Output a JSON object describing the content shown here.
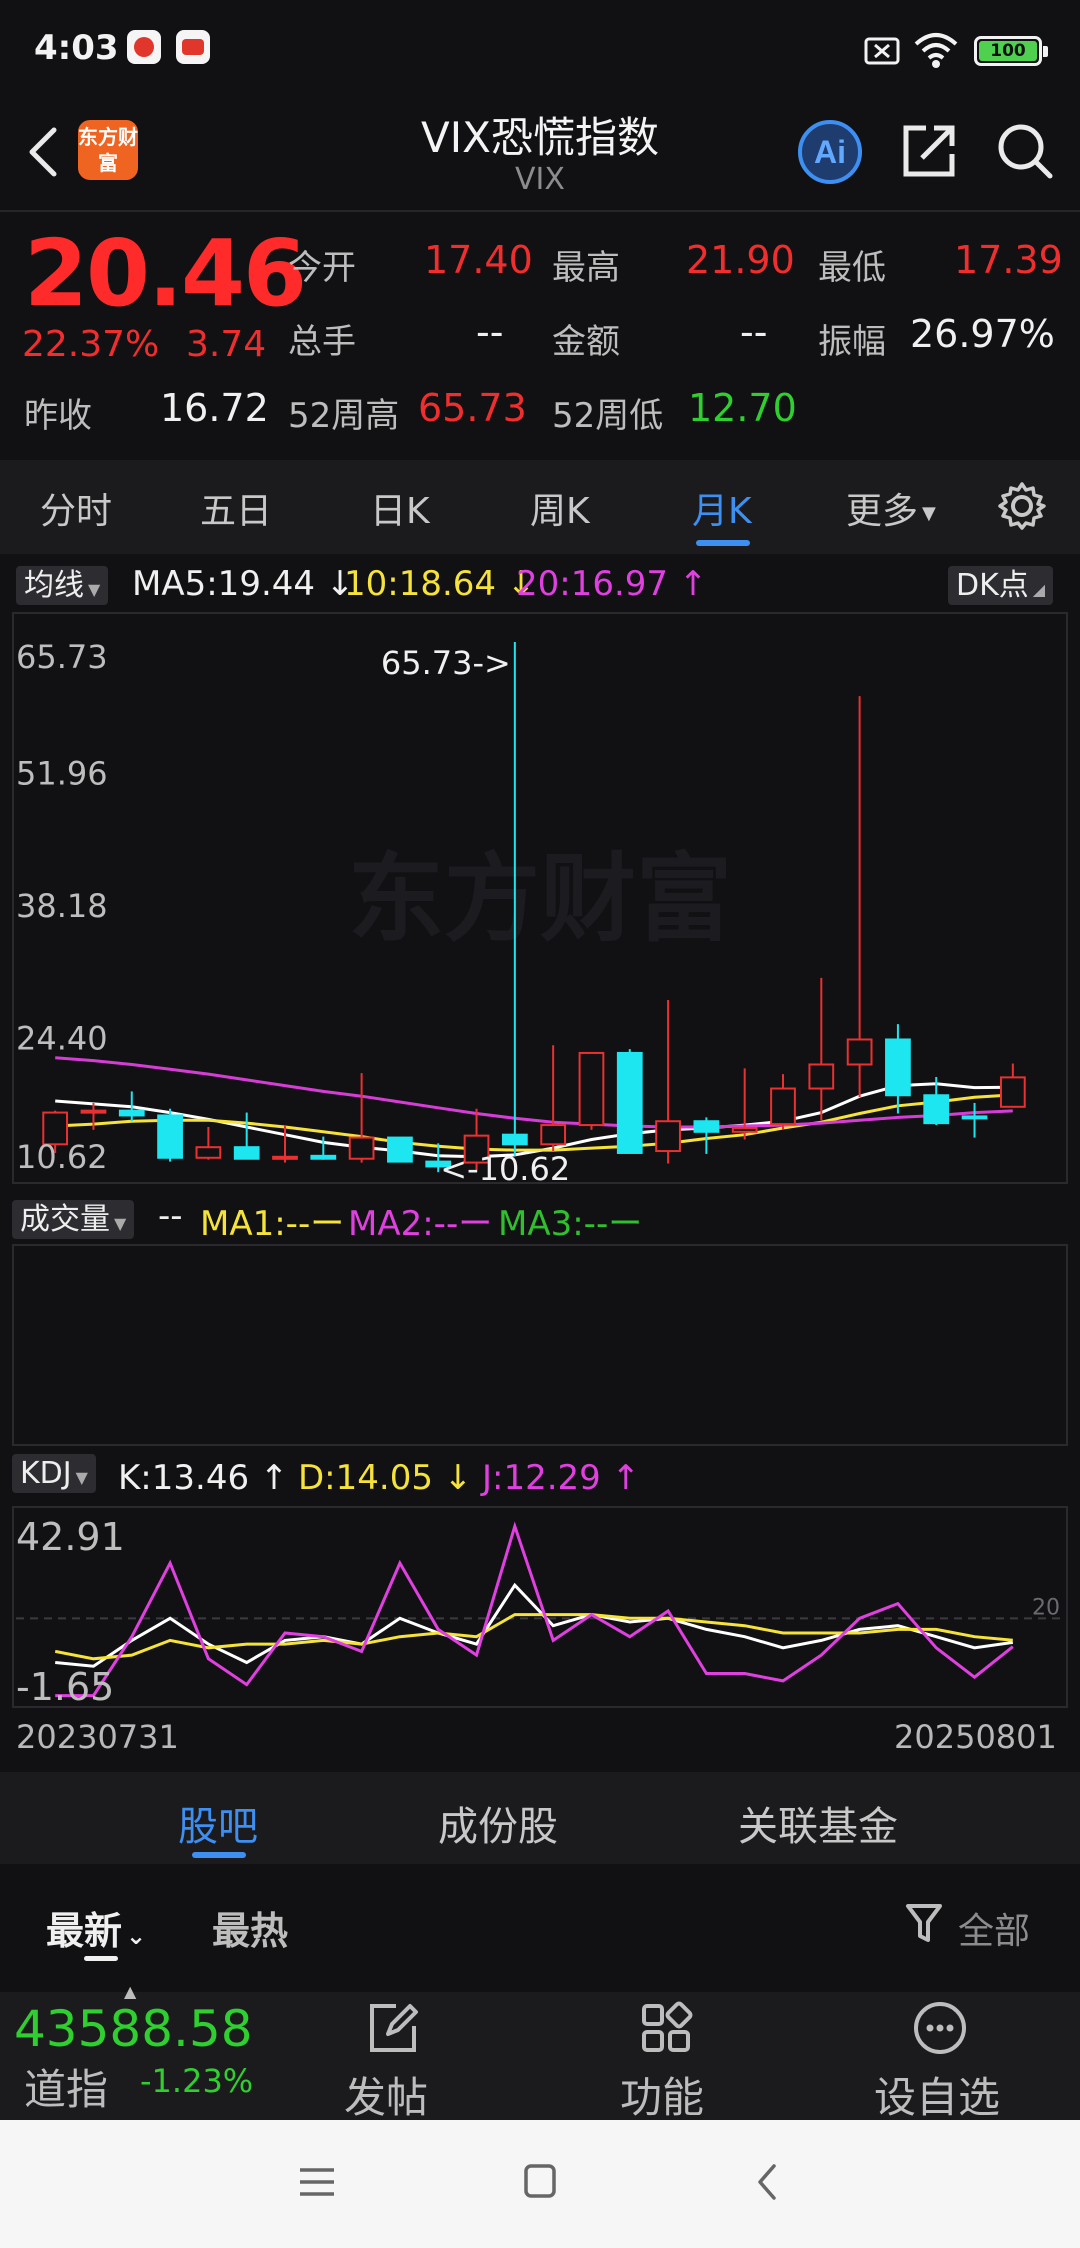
{
  "status_bar": {
    "time": "4:03",
    "battery": "100"
  },
  "header": {
    "title": "VIX恐慌指数",
    "subtitle": "VIX",
    "logo_text": "东方财富"
  },
  "quote": {
    "price": "20.46",
    "change_pct": "22.37%",
    "change": "3.74",
    "prev_close_label": "昨收",
    "prev_close": "16.72",
    "open_label": "今开",
    "open": "17.40",
    "high_label": "最高",
    "high": "21.90",
    "low_label": "最低",
    "low": "17.39",
    "volume_label": "总手",
    "volume": "--",
    "amount_label": "金额",
    "amount": "--",
    "amplitude_label": "振幅",
    "amplitude": "26.97%",
    "wk52_high_label": "52周高",
    "wk52_high": "65.73",
    "wk52_low_label": "52周低",
    "wk52_low": "12.70"
  },
  "chart_tabs": [
    "分时",
    "五日",
    "日K",
    "周K",
    "月K",
    "更多"
  ],
  "active_chart_tab": "月K",
  "ma_row": {
    "tag": "均线",
    "ma5": "MA5:19.44 ↓",
    "ma10": "10:18.64 ↓",
    "ma20": "20:16.97 ↑",
    "dk": "DK点"
  },
  "volume_row": {
    "tag": "成交量",
    "dash": "--",
    "ma1": "MA1:--ー",
    "ma2": "MA2:--ー",
    "ma3": "MA3:--ー"
  },
  "kdj_row": {
    "tag": "KDJ",
    "k": "K:13.46 ↑",
    "d": "D:14.05 ↓",
    "j": "J:12.29 ↑"
  },
  "watermark": "东方财富",
  "chart_data": [
    {
      "type": "candlestick",
      "title": "月K",
      "y_ticks": [
        "65.73",
        "51.96",
        "38.18",
        "24.40",
        "10.62"
      ],
      "ylim": [
        10.62,
        65.73
      ],
      "max_annotation": "65.73->",
      "min_annotation": "<-10.62",
      "candles": [
        {
          "o": 13.5,
          "h": 17.0,
          "l": 12.6,
          "c": 16.8
        },
        {
          "o": 16.8,
          "h": 17.8,
          "l": 15.0,
          "c": 17.0
        },
        {
          "o": 17.0,
          "h": 19.0,
          "l": 15.9,
          "c": 16.5
        },
        {
          "o": 16.5,
          "h": 17.2,
          "l": 11.7,
          "c": 12.1
        },
        {
          "o": 12.1,
          "h": 15.3,
          "l": 11.9,
          "c": 13.2
        },
        {
          "o": 13.2,
          "h": 16.8,
          "l": 12.0,
          "c": 12.0
        },
        {
          "o": 12.0,
          "h": 15.5,
          "l": 11.6,
          "c": 12.2
        },
        {
          "o": 12.3,
          "h": 14.3,
          "l": 11.9,
          "c": 12.0
        },
        {
          "o": 12.0,
          "h": 20.9,
          "l": 11.6,
          "c": 14.2
        },
        {
          "o": 14.2,
          "h": 14.2,
          "l": 11.7,
          "c": 11.7
        },
        {
          "o": 11.7,
          "h": 13.6,
          "l": 10.6,
          "c": 11.2
        },
        {
          "o": 11.6,
          "h": 17.2,
          "l": 10.6,
          "c": 14.4
        },
        {
          "o": 14.5,
          "h": 65.73,
          "l": 12.3,
          "c": 13.5
        },
        {
          "o": 13.5,
          "h": 23.8,
          "l": 12.8,
          "c": 15.5
        },
        {
          "o": 15.5,
          "h": 23.0,
          "l": 15.0,
          "c": 23.0
        },
        {
          "o": 23.0,
          "h": 23.4,
          "l": 12.6,
          "c": 12.6
        },
        {
          "o": 12.8,
          "h": 28.5,
          "l": 11.5,
          "c": 15.9
        },
        {
          "o": 15.9,
          "h": 16.3,
          "l": 12.5,
          "c": 14.8
        },
        {
          "o": 14.8,
          "h": 21.4,
          "l": 14.0,
          "c": 15.2
        },
        {
          "o": 15.6,
          "h": 20.8,
          "l": 15.0,
          "c": 19.3
        },
        {
          "o": 19.3,
          "h": 30.8,
          "l": 16.0,
          "c": 21.8
        },
        {
          "o": 21.8,
          "h": 60.1,
          "l": 18.4,
          "c": 24.4
        },
        {
          "o": 24.4,
          "h": 26.0,
          "l": 16.7,
          "c": 18.6
        },
        {
          "o": 18.6,
          "h": 20.5,
          "l": 15.5,
          "c": 15.7
        },
        {
          "o": 16.4,
          "h": 17.8,
          "l": 14.2,
          "c": 16.2
        },
        {
          "o": 17.4,
          "h": 21.9,
          "l": 17.4,
          "c": 20.46
        }
      ],
      "ma5": [
        18.0,
        17.7,
        17.4,
        16.8,
        16.1,
        15.3,
        14.5,
        13.7,
        13.2,
        12.8,
        12.3,
        12.2,
        12.4,
        13.1,
        14.0,
        14.6,
        15.0,
        15.2,
        15.5,
        15.9,
        16.8,
        18.5,
        19.6,
        19.8,
        19.4,
        19.44
      ],
      "ma10": [
        15.4,
        15.6,
        15.9,
        16.0,
        16.0,
        15.7,
        15.3,
        14.8,
        14.3,
        13.7,
        13.3,
        13.0,
        12.9,
        12.9,
        13.1,
        13.3,
        13.6,
        14.1,
        14.5,
        15.2,
        15.8,
        16.7,
        17.5,
        17.9,
        18.4,
        18.64
      ],
      "ma20": [
        22.5,
        22.2,
        21.8,
        21.3,
        20.8,
        20.2,
        19.6,
        19.0,
        18.5,
        17.9,
        17.3,
        16.7,
        16.2,
        15.8,
        15.6,
        15.4,
        15.3,
        15.3,
        15.4,
        15.5,
        15.7,
        16.0,
        16.3,
        16.5,
        16.8,
        16.97
      ]
    },
    {
      "type": "line",
      "title": "KDJ",
      "y_ticks": [
        "42.91",
        "-1.65"
      ],
      "ylim": [
        -1.65,
        42.91
      ],
      "reference_line": "20",
      "series": [
        {
          "name": "K",
          "values": [
            8,
            7,
            14,
            20,
            13,
            8,
            14,
            15,
            13,
            20,
            16,
            13,
            29,
            18,
            21,
            19,
            20,
            17,
            15,
            12,
            14,
            17,
            18,
            15,
            12,
            13.46
          ]
        },
        {
          "name": "D",
          "values": [
            11,
            9,
            10,
            14,
            12,
            13,
            13,
            14,
            13,
            15,
            16,
            15,
            21,
            21,
            21,
            20,
            20,
            19,
            18,
            16,
            16,
            16,
            17,
            17,
            15,
            14.05
          ]
        },
        {
          "name": "J",
          "values": [
            -1,
            -1,
            15,
            35,
            9,
            2,
            16,
            15,
            11,
            35,
            17,
            10,
            45,
            14,
            21,
            15,
            22,
            5,
            5,
            3,
            10,
            20,
            24,
            12,
            4,
            12.29
          ]
        }
      ]
    }
  ],
  "x_range": {
    "start": "20230731",
    "end": "20250801"
  },
  "section_tabs": [
    "股吧",
    "成份股",
    "关联基金"
  ],
  "active_section_tab": "股吧",
  "filters": {
    "latest": "最新",
    "hottest": "最热",
    "all": "全部"
  },
  "dock": {
    "index_value": "43588.58",
    "index_name": "道指",
    "index_change": "-1.23%",
    "post": "发帖",
    "functions": "功能",
    "watchlist": "设自选"
  }
}
